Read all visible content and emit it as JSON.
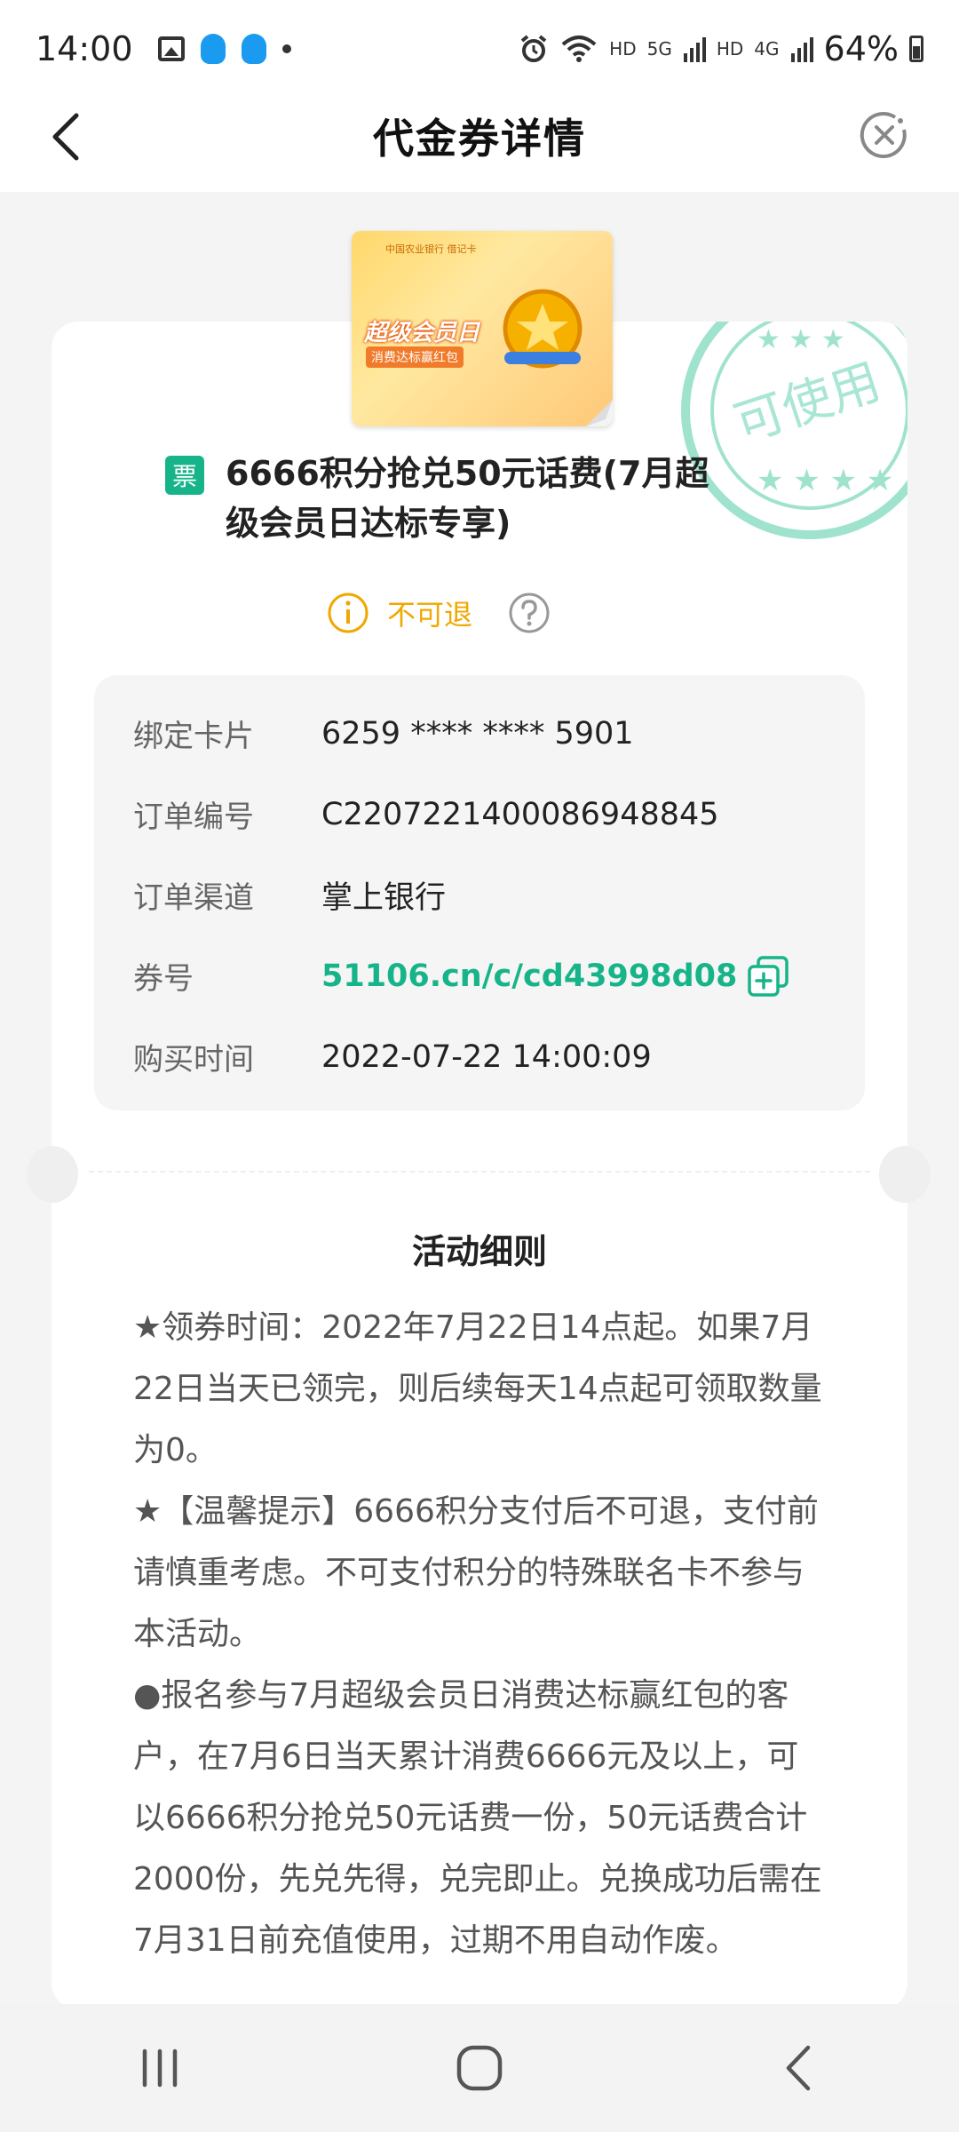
{
  "status_bar": {
    "time": "14:00",
    "battery": "64%",
    "network_labels": [
      "HD",
      "5G",
      "HD",
      "4G"
    ]
  },
  "header": {
    "title": "代金券详情"
  },
  "stamp": {
    "text": "可使用",
    "color": "#17b48a"
  },
  "coupon": {
    "image_brand": "中国农业银行 借记卡",
    "image_main": "超级会员日",
    "image_sub": "消费达标赢红包",
    "badge": "票",
    "title": "6666积分抢兑50元话费(7月超级会员日达标专享)",
    "refund_status": "不可退"
  },
  "info": {
    "rows": [
      {
        "label": "绑定卡片",
        "value": "6259 **** **** 5901"
      },
      {
        "label": "订单编号",
        "value": "C2207221400086948845"
      },
      {
        "label": "订单渠道",
        "value": "掌上银行"
      },
      {
        "label": "券号",
        "value": "51106.cn/c/cd43998d08"
      },
      {
        "label": "购买时间",
        "value": "2022-07-22 14:00:09"
      }
    ]
  },
  "rules": {
    "title": "活动细则",
    "paragraphs": [
      "★领券时间：2022年7月22日14点起。如果7月22日当天已领完，则后续每天14点起可领取数量为0。",
      "★【温馨提示】6666积分支付后不可退，支付前请慎重考虑。不可支付积分的特殊联名卡不参与本活动。",
      "●报名参与7月超级会员日消费达标赢红包的客户，在7月6日当天累计消费6666元及以上，可以6666积分抢兑50元话费一份，50元话费合计2000份，先兑先得，兑完即止。兑换成功后需在7月31日前充值使用，过期不用自动作废。"
    ]
  },
  "colors": {
    "accent": "#17b48a",
    "warning": "#f0a800"
  },
  "icons": {
    "back": "chevron-left",
    "close": "close-circle",
    "info": "info-circle",
    "help": "question-circle",
    "copy": "copy",
    "nav": [
      "recent-apps",
      "home",
      "back"
    ]
  }
}
